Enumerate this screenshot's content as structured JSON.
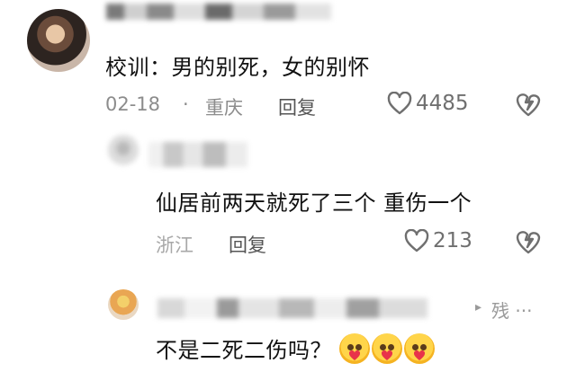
{
  "comment1": {
    "text": "校训：男的别死，女的别怀",
    "date": "02-18",
    "separator": "·",
    "location": "重庆",
    "reply_label": "回复",
    "likes": "4485"
  },
  "reply1": {
    "text": "仙居前两天就死了三个 重伤一个",
    "location": "浙江",
    "reply_label": "回复",
    "likes": "213"
  },
  "reply2": {
    "text": "不是二死二伤吗？",
    "emojis": [
      "heart-hug-emoji",
      "heart-hug-emoji",
      "heart-hug-emoji"
    ],
    "tag": "残 ···",
    "arrow": "▸"
  },
  "colors": {
    "text": "#111111",
    "meta": "#8c8c8c",
    "icon": "#6f6f6f",
    "emoji_heart": "#e8334a"
  }
}
